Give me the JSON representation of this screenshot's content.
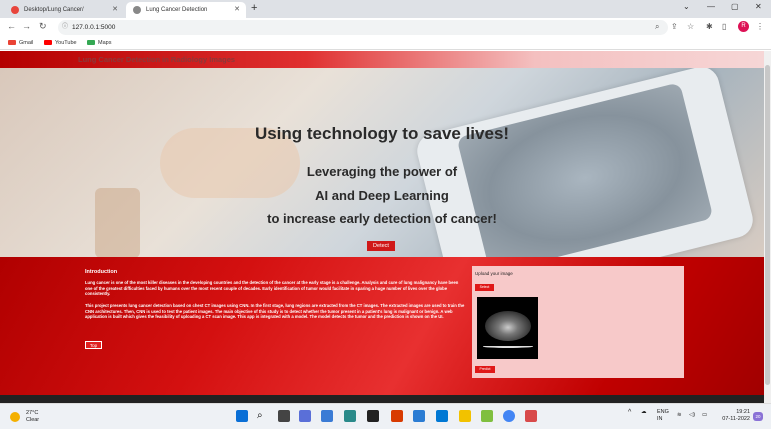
{
  "browser": {
    "tabs": [
      {
        "label": "Desktop/Lung Cancer/"
      },
      {
        "label": "Lung Cancer Detection"
      }
    ],
    "new_tab": "+",
    "url": "127.0.0.1:5000",
    "profile_initial": "R",
    "bookmarks": [
      {
        "label": "Gmail"
      },
      {
        "label": "YouTube"
      },
      {
        "label": "Maps"
      }
    ]
  },
  "page": {
    "brand": "Lung Cancer Detection in Radiology Images",
    "hero": {
      "title": "Using technology to save lives!",
      "line1": "Leveraging the power of",
      "line2": "AI and Deep Learning",
      "line3": "to increase early detection of cancer!",
      "button": "Detect"
    },
    "intro": {
      "title": "Introduction",
      "p1": "Lung cancer is one of the most killer diseases in the developing countries and the detection of the cancer at the early stage is a challenge. Analysis and cure of lung malignancy have been one of the greatest difficulties faced by humans over the most recent couple of decades. Early identification of tumor would facilitate in sparing a huge number of lives over the globe consistently.",
      "p2": "This project presents lung cancer detection based on chest CT images using CNN. In the first stage, lung regions are extracted from the CT images. The extracted images are used to train the CNN architectures. Then, CNN is used to test the patient images. The main objective of this study is to detect whether the tumor present in a patient's lung is malignant or benign. A web application is built which gives the feasibility of uploading a CT scan image. This app is integrated with a model. The model detects the tumor and the prediction is shown on the UI.",
      "button": "Top"
    },
    "upload": {
      "title": "Upload your image",
      "select_button": "Select",
      "predict_button": "Predict"
    }
  },
  "taskbar": {
    "temperature": "27°C",
    "weather": "Clear",
    "lang": "ENG",
    "region": "IN",
    "time": "19:21",
    "date": "07-11-2022",
    "notifications": "20"
  }
}
